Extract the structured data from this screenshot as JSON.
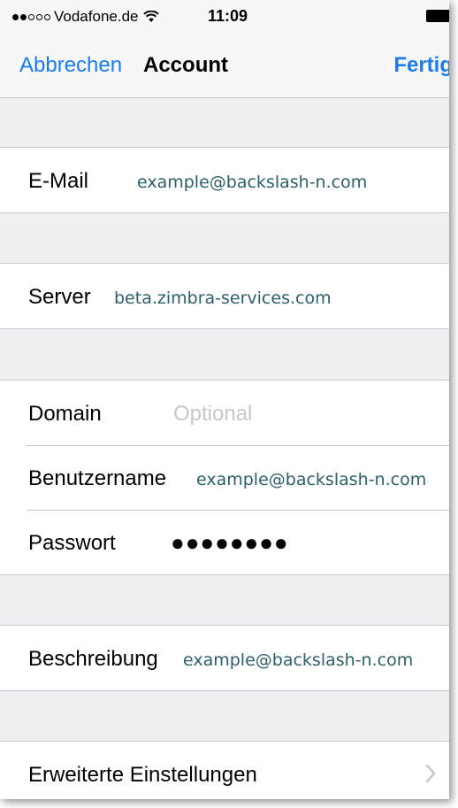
{
  "status_bar": {
    "carrier": "Vodafone.de",
    "time": "11:09",
    "signal_filled": 2,
    "signal_total": 5
  },
  "nav": {
    "cancel_label": "Abbrechen",
    "title": "Account",
    "done_label": "Fertig"
  },
  "email": {
    "label": "E-Mail",
    "value": "example@backslash-n.com"
  },
  "server": {
    "label": "Server",
    "value": "beta.zimbra-services.com"
  },
  "domain": {
    "label": "Domain",
    "placeholder": "Optional"
  },
  "username": {
    "label": "Benutzername",
    "value": "example@backslash-n.com"
  },
  "password": {
    "label": "Passwort",
    "masked": "●●●●●●●●"
  },
  "description": {
    "label": "Beschreibung",
    "value": "example@backslash-n.com"
  },
  "advanced": {
    "label": "Erweiterte Einstellungen"
  },
  "colors": {
    "accent": "#1a7cf5",
    "background": "#efeff4",
    "value_text": "#2b6069"
  }
}
